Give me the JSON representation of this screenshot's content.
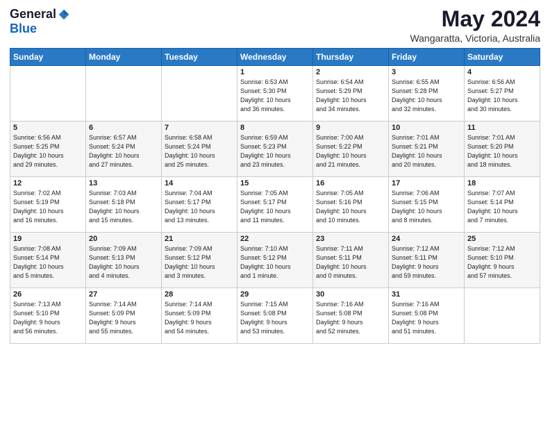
{
  "header": {
    "logo_general": "General",
    "logo_blue": "Blue",
    "month_title": "May 2024",
    "location": "Wangaratta, Victoria, Australia"
  },
  "weekdays": [
    "Sunday",
    "Monday",
    "Tuesday",
    "Wednesday",
    "Thursday",
    "Friday",
    "Saturday"
  ],
  "weeks": [
    [
      {
        "day": "",
        "info": ""
      },
      {
        "day": "",
        "info": ""
      },
      {
        "day": "",
        "info": ""
      },
      {
        "day": "1",
        "info": "Sunrise: 6:53 AM\nSunset: 5:30 PM\nDaylight: 10 hours\nand 36 minutes."
      },
      {
        "day": "2",
        "info": "Sunrise: 6:54 AM\nSunset: 5:29 PM\nDaylight: 10 hours\nand 34 minutes."
      },
      {
        "day": "3",
        "info": "Sunrise: 6:55 AM\nSunset: 5:28 PM\nDaylight: 10 hours\nand 32 minutes."
      },
      {
        "day": "4",
        "info": "Sunrise: 6:56 AM\nSunset: 5:27 PM\nDaylight: 10 hours\nand 30 minutes."
      }
    ],
    [
      {
        "day": "5",
        "info": "Sunrise: 6:56 AM\nSunset: 5:25 PM\nDaylight: 10 hours\nand 29 minutes."
      },
      {
        "day": "6",
        "info": "Sunrise: 6:57 AM\nSunset: 5:24 PM\nDaylight: 10 hours\nand 27 minutes."
      },
      {
        "day": "7",
        "info": "Sunrise: 6:58 AM\nSunset: 5:24 PM\nDaylight: 10 hours\nand 25 minutes."
      },
      {
        "day": "8",
        "info": "Sunrise: 6:59 AM\nSunset: 5:23 PM\nDaylight: 10 hours\nand 23 minutes."
      },
      {
        "day": "9",
        "info": "Sunrise: 7:00 AM\nSunset: 5:22 PM\nDaylight: 10 hours\nand 21 minutes."
      },
      {
        "day": "10",
        "info": "Sunrise: 7:01 AM\nSunset: 5:21 PM\nDaylight: 10 hours\nand 20 minutes."
      },
      {
        "day": "11",
        "info": "Sunrise: 7:01 AM\nSunset: 5:20 PM\nDaylight: 10 hours\nand 18 minutes."
      }
    ],
    [
      {
        "day": "12",
        "info": "Sunrise: 7:02 AM\nSunset: 5:19 PM\nDaylight: 10 hours\nand 16 minutes."
      },
      {
        "day": "13",
        "info": "Sunrise: 7:03 AM\nSunset: 5:18 PM\nDaylight: 10 hours\nand 15 minutes."
      },
      {
        "day": "14",
        "info": "Sunrise: 7:04 AM\nSunset: 5:17 PM\nDaylight: 10 hours\nand 13 minutes."
      },
      {
        "day": "15",
        "info": "Sunrise: 7:05 AM\nSunset: 5:17 PM\nDaylight: 10 hours\nand 11 minutes."
      },
      {
        "day": "16",
        "info": "Sunrise: 7:05 AM\nSunset: 5:16 PM\nDaylight: 10 hours\nand 10 minutes."
      },
      {
        "day": "17",
        "info": "Sunrise: 7:06 AM\nSunset: 5:15 PM\nDaylight: 10 hours\nand 8 minutes."
      },
      {
        "day": "18",
        "info": "Sunrise: 7:07 AM\nSunset: 5:14 PM\nDaylight: 10 hours\nand 7 minutes."
      }
    ],
    [
      {
        "day": "19",
        "info": "Sunrise: 7:08 AM\nSunset: 5:14 PM\nDaylight: 10 hours\nand 5 minutes."
      },
      {
        "day": "20",
        "info": "Sunrise: 7:09 AM\nSunset: 5:13 PM\nDaylight: 10 hours\nand 4 minutes."
      },
      {
        "day": "21",
        "info": "Sunrise: 7:09 AM\nSunset: 5:12 PM\nDaylight: 10 hours\nand 3 minutes."
      },
      {
        "day": "22",
        "info": "Sunrise: 7:10 AM\nSunset: 5:12 PM\nDaylight: 10 hours\nand 1 minute."
      },
      {
        "day": "23",
        "info": "Sunrise: 7:11 AM\nSunset: 5:11 PM\nDaylight: 10 hours\nand 0 minutes."
      },
      {
        "day": "24",
        "info": "Sunrise: 7:12 AM\nSunset: 5:11 PM\nDaylight: 9 hours\nand 59 minutes."
      },
      {
        "day": "25",
        "info": "Sunrise: 7:12 AM\nSunset: 5:10 PM\nDaylight: 9 hours\nand 57 minutes."
      }
    ],
    [
      {
        "day": "26",
        "info": "Sunrise: 7:13 AM\nSunset: 5:10 PM\nDaylight: 9 hours\nand 56 minutes."
      },
      {
        "day": "27",
        "info": "Sunrise: 7:14 AM\nSunset: 5:09 PM\nDaylight: 9 hours\nand 55 minutes."
      },
      {
        "day": "28",
        "info": "Sunrise: 7:14 AM\nSunset: 5:09 PM\nDaylight: 9 hours\nand 54 minutes."
      },
      {
        "day": "29",
        "info": "Sunrise: 7:15 AM\nSunset: 5:08 PM\nDaylight: 9 hours\nand 53 minutes."
      },
      {
        "day": "30",
        "info": "Sunrise: 7:16 AM\nSunset: 5:08 PM\nDaylight: 9 hours\nand 52 minutes."
      },
      {
        "day": "31",
        "info": "Sunrise: 7:16 AM\nSunset: 5:08 PM\nDaylight: 9 hours\nand 51 minutes."
      },
      {
        "day": "",
        "info": ""
      }
    ]
  ]
}
